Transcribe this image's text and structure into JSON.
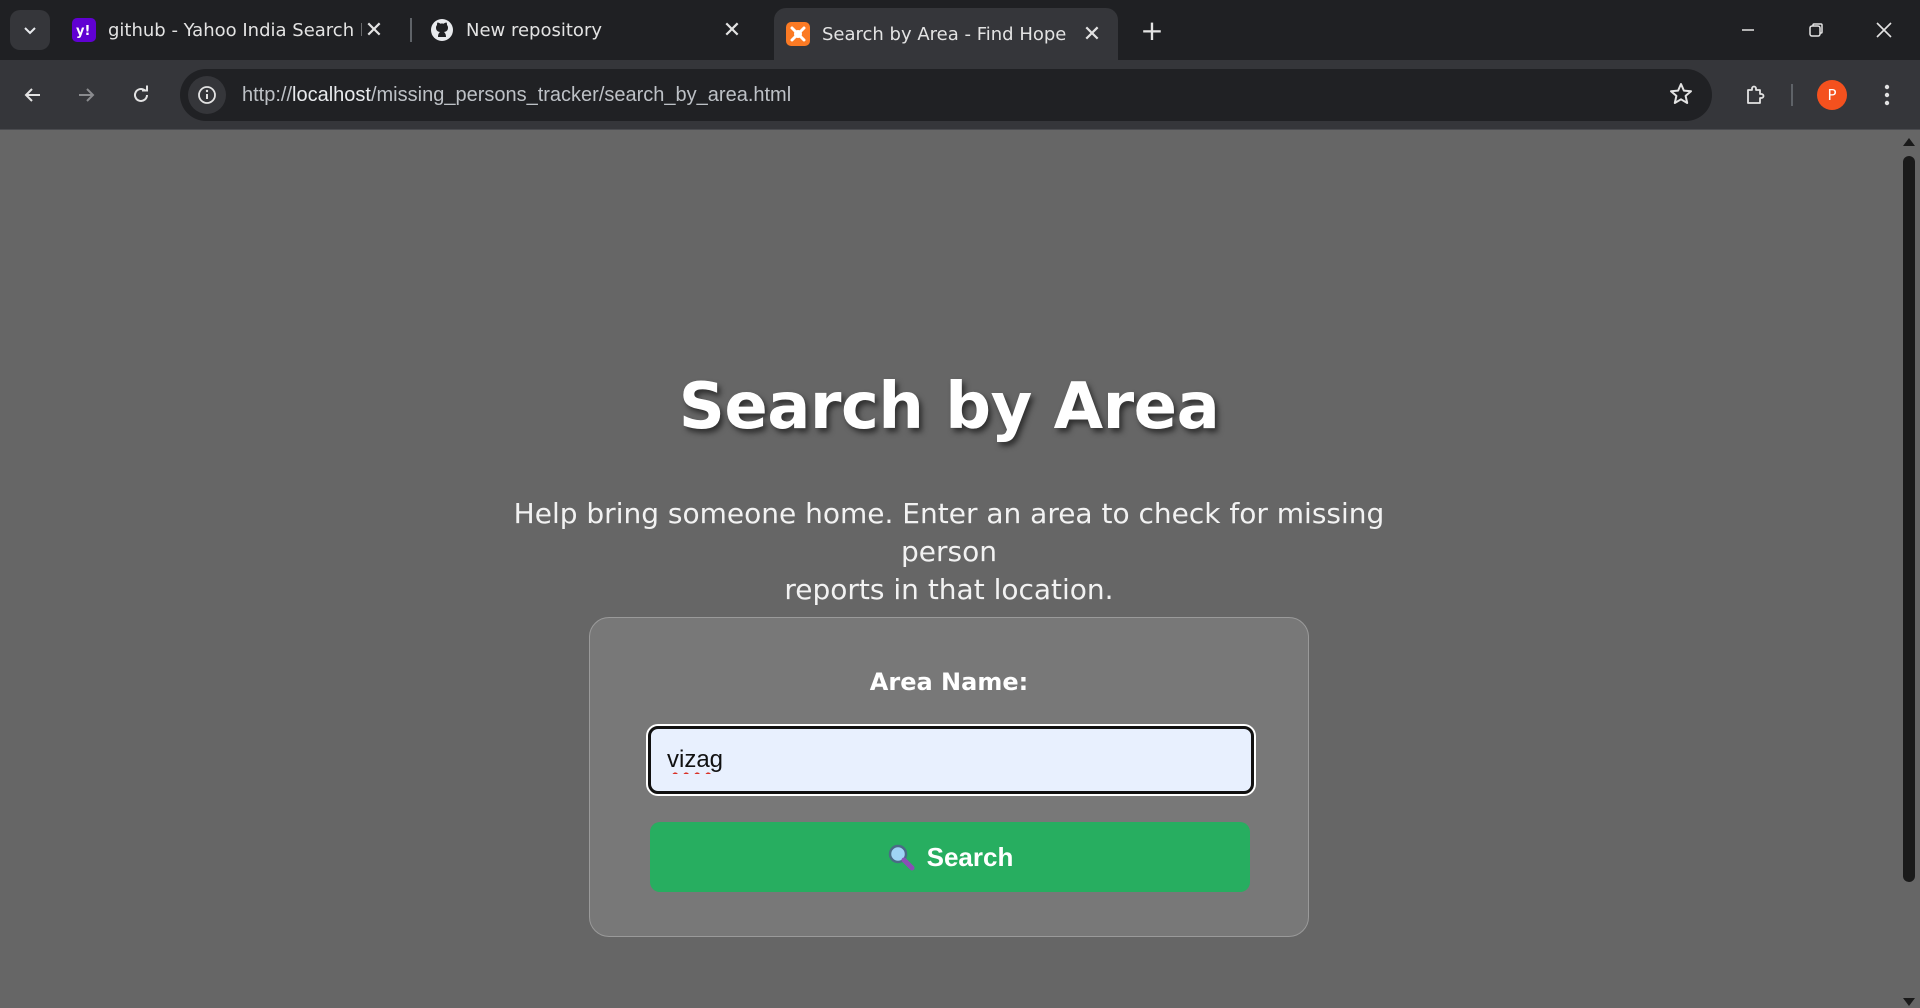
{
  "browser": {
    "tabs": [
      {
        "title": "github - Yahoo India Search Re",
        "favicon": "yahoo-icon",
        "active": false
      },
      {
        "title": "New repository",
        "favicon": "github-icon",
        "active": false
      },
      {
        "title": "Search by Area - Find Hope",
        "favicon": "xampp-icon",
        "active": true
      }
    ],
    "url_prefix": "http://",
    "url_host": "localhost",
    "url_path": "/missing_persons_tracker/search_by_area.html",
    "profile_initial": "P"
  },
  "page": {
    "title": "Search by Area",
    "subtitle_line1": "Help bring someone home. Enter an area to check for missing person",
    "subtitle_line2": "reports in that location.",
    "form": {
      "label": "Area Name:",
      "input_value": "vizag",
      "button_label": "Search"
    }
  },
  "colors": {
    "page_background": "#666666",
    "button_green": "#27ae60",
    "avatar": "#f4511e"
  }
}
